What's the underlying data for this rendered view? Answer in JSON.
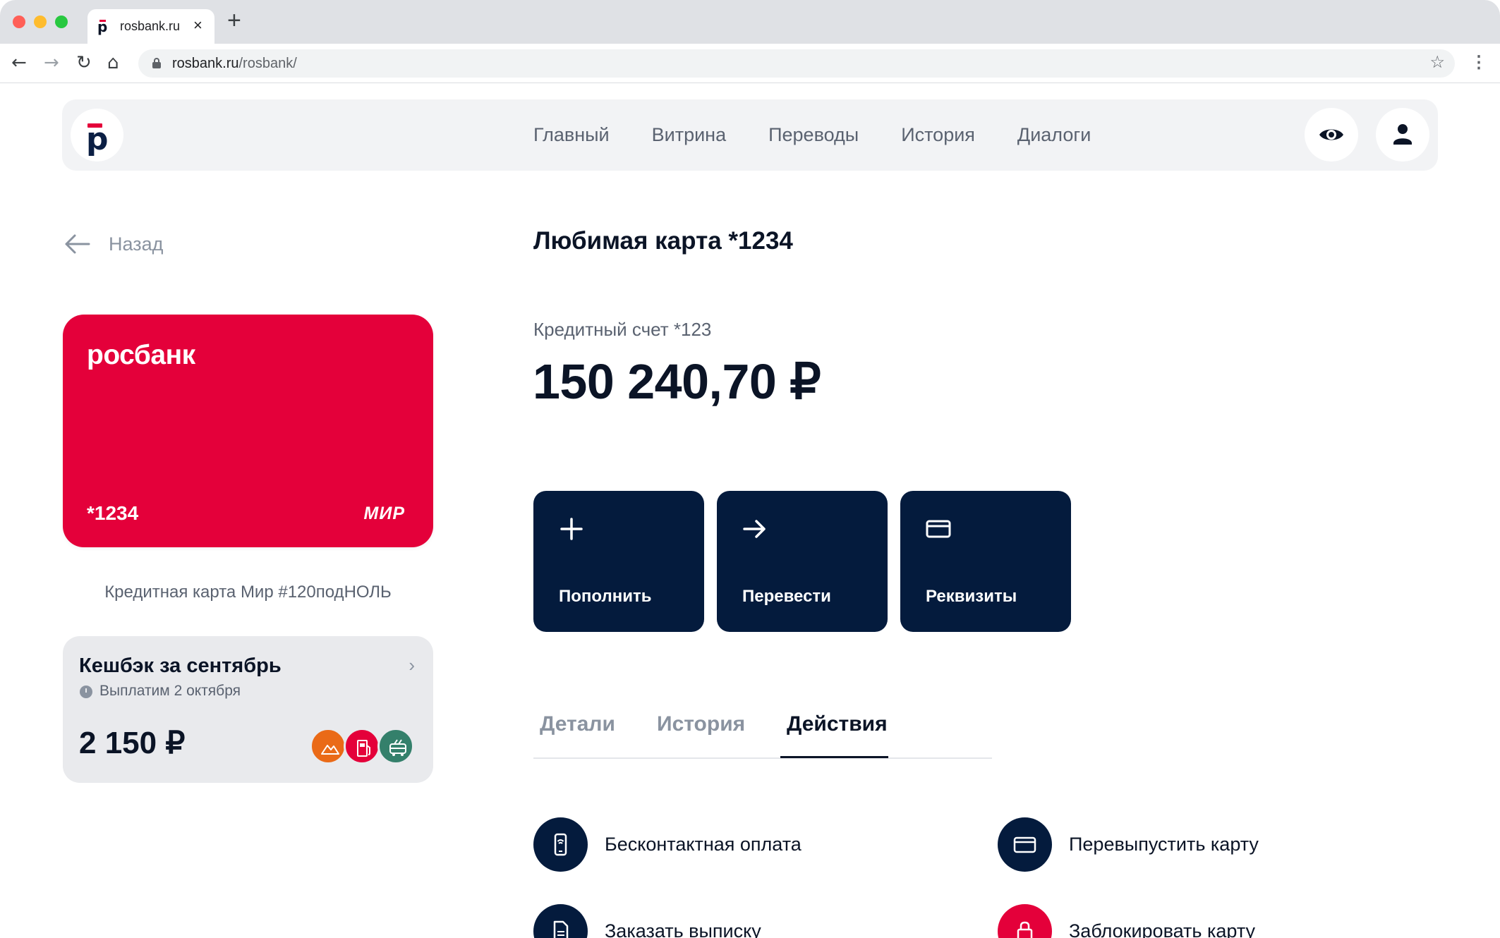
{
  "browser": {
    "tab_title": "rosbank.ru",
    "url_host": "rosbank.ru",
    "url_path": "/rosbank/"
  },
  "nav": {
    "items": [
      {
        "label": "Главный"
      },
      {
        "label": "Витрина"
      },
      {
        "label": "Переводы"
      },
      {
        "label": "История"
      },
      {
        "label": "Диалоги"
      }
    ]
  },
  "back": {
    "label": "Назад"
  },
  "card": {
    "brand": "росбанк",
    "number": "*1234",
    "payment_system": "МИР",
    "caption": "Кредитная карта Мир #120подНОЛЬ",
    "color": "#e4003a"
  },
  "cashback": {
    "title": "Кешбэк за сентябрь",
    "payout_date": "Выплатим 2 октября",
    "amount": "2 150 ₽",
    "categories": [
      {
        "icon": "mountains-icon",
        "color": "#ea6a17"
      },
      {
        "icon": "fuel-pump-icon",
        "color": "#e4003a"
      },
      {
        "icon": "trolleybus-icon",
        "color": "#34806b"
      }
    ]
  },
  "account": {
    "title": "Любимая карта *1234",
    "label": "Кредитный счет *123",
    "balance": "150 240,70 ₽"
  },
  "quick_actions": [
    {
      "label": "Пополнить",
      "icon": "plus-icon"
    },
    {
      "label": "Перевести",
      "icon": "arrow-right-icon"
    },
    {
      "label": "Реквизиты",
      "icon": "card-icon"
    }
  ],
  "tabs": [
    {
      "label": "Детали",
      "active": false
    },
    {
      "label": "История",
      "active": false
    },
    {
      "label": "Действия",
      "active": true
    }
  ],
  "card_actions": [
    {
      "label": "Бесконтактная оплата",
      "icon": "contactless-phone-icon"
    },
    {
      "label": "Перевыпустить карту",
      "icon": "card-icon"
    },
    {
      "label": "Заказать выписку",
      "icon": "document-icon"
    },
    {
      "label": "Заблокировать карту",
      "icon": "lock-icon"
    }
  ],
  "colors": {
    "brand_red": "#e4003a",
    "navy": "#041b3d",
    "header_bg": "#f2f3f5"
  }
}
